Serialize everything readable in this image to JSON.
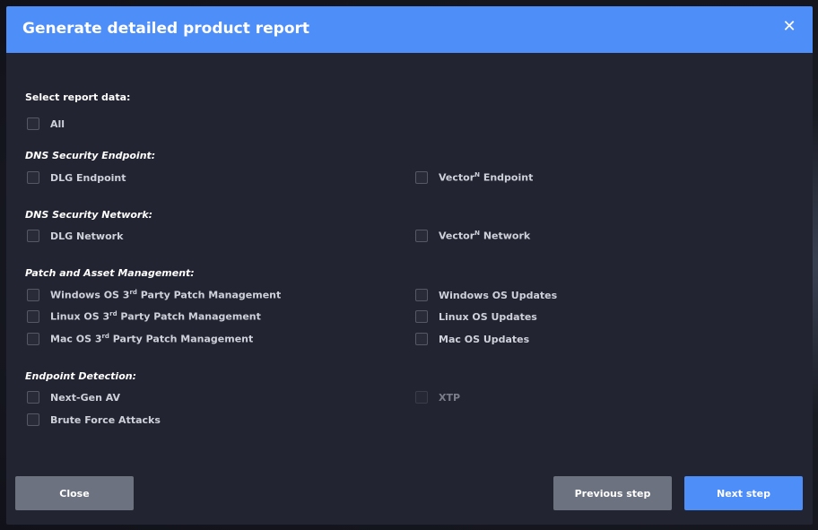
{
  "modal": {
    "title": "Generate detailed product report",
    "close_icon": "close-icon"
  },
  "select_label": "Select report data:",
  "all_label": "All",
  "sections": {
    "dns_endpoint": {
      "title": "DNS Security Endpoint:",
      "dlg": "DLG Endpoint",
      "vector_pre": "Vector",
      "vector_sup": "N",
      "vector_post": " Endpoint"
    },
    "dns_network": {
      "title": "DNS Security Network:",
      "dlg": "DLG Network",
      "vector_pre": "Vector",
      "vector_sup": "N",
      "vector_post": " Network"
    },
    "patch": {
      "title": "Patch and Asset Management:",
      "win3_pre": "Windows OS 3",
      "linux3_pre": "Linux OS 3",
      "mac3_pre": "Mac OS 3",
      "rd_sup": "rd",
      "third_post": " Party Patch Management",
      "win_updates": "Windows OS Updates",
      "linux_updates": "Linux OS Updates",
      "mac_updates": "Mac OS Updates"
    },
    "endpoint_detection": {
      "title": "Endpoint Detection:",
      "ngav": "Next-Gen AV",
      "xtp": "XTP",
      "brute": "Brute Force Attacks"
    }
  },
  "buttons": {
    "close": "Close",
    "previous": "Previous step",
    "next": "Next step"
  },
  "colors": {
    "header_blue": "#4e8ef8",
    "modal_bg": "#232431",
    "secondary_button": "#6c7280"
  }
}
